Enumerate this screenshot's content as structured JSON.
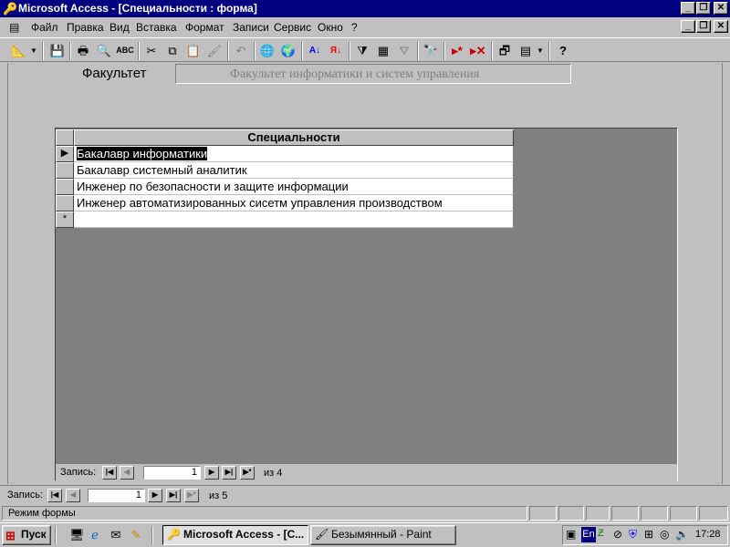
{
  "window": {
    "title": "Microsoft Access - [Специальности : форма]"
  },
  "menu": {
    "items": [
      "Файл",
      "Правка",
      "Вид",
      "Вставка",
      "Формат",
      "Записи",
      "Сервис",
      "Окно",
      "?"
    ]
  },
  "form": {
    "faculty_label": "Факультет",
    "faculty_value": "Факультет информатики и систем управления"
  },
  "datasheet": {
    "column_header": "Специальности",
    "rows": [
      "Бакалавр информатики",
      "Бакалавр системный аналитик",
      "Инженер по безопасности и защите информации",
      "Инженер автоматизированных сисетм управления производством"
    ],
    "new_row_marker": "*",
    "current_row_marker": "▶"
  },
  "subform_nav": {
    "label": "Запись:",
    "current": "1",
    "of_text": "из 4"
  },
  "main_nav": {
    "label": "Запись:",
    "current": "1",
    "of_text": "из 5"
  },
  "status": {
    "text": "Режим формы"
  },
  "taskbar": {
    "start_label": "Пуск",
    "tasks": [
      "Microsoft Access - [С...",
      "Безымянный - Paint"
    ],
    "tray_lang": "En",
    "clock": "17:28"
  },
  "colors": {
    "title_bg": "#000080",
    "face": "#c0c0c0",
    "subform_bg": "#808080",
    "selection": "#000000"
  }
}
